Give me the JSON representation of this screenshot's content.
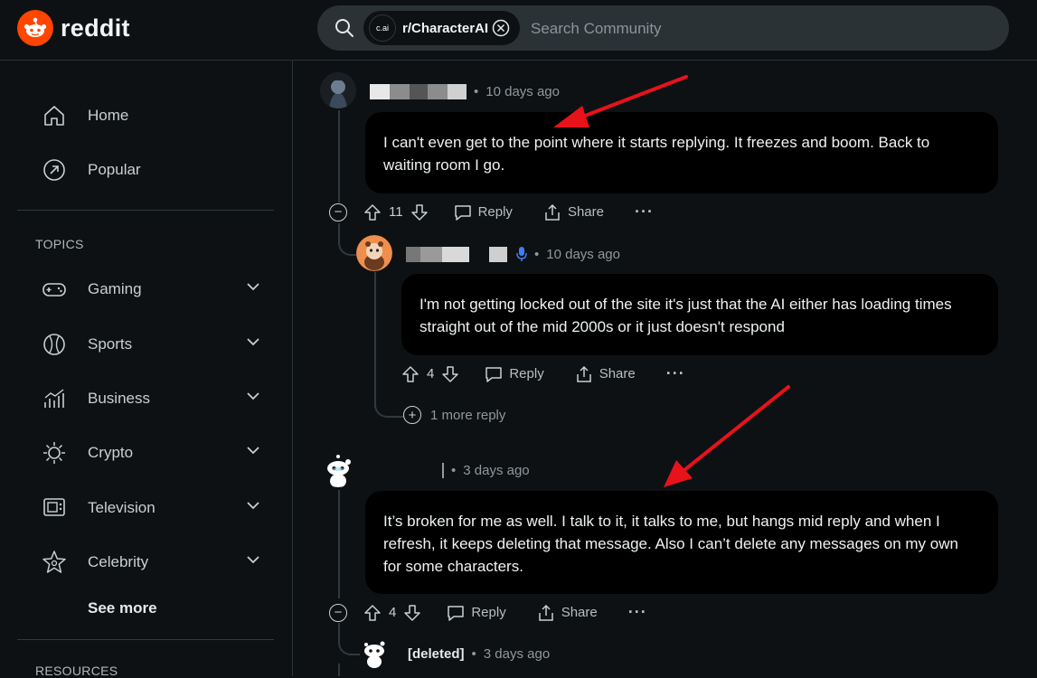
{
  "header": {
    "brand": "reddit",
    "community_chip": {
      "icon_text": "c.ai",
      "name": "r/CharacterAI"
    },
    "search_placeholder": "Search Community"
  },
  "sidebar": {
    "nav": [
      {
        "label": "Home",
        "icon": "home-icon"
      },
      {
        "label": "Popular",
        "icon": "popular-icon"
      }
    ],
    "topics_heading": "TOPICS",
    "topics": [
      {
        "label": "Gaming",
        "icon": "gamepad-icon"
      },
      {
        "label": "Sports",
        "icon": "sports-ball-icon"
      },
      {
        "label": "Business",
        "icon": "chart-icon"
      },
      {
        "label": "Crypto",
        "icon": "crypto-icon"
      },
      {
        "label": "Television",
        "icon": "tv-icon"
      },
      {
        "label": "Celebrity",
        "icon": "star-icon"
      }
    ],
    "see_more": "See more",
    "resources_heading": "RESOURCES"
  },
  "comments": [
    {
      "time": "10 days ago",
      "body": "I can't even get to the point where it starts replying. It freezes and boom. Back to waiting room I go.",
      "score": "11",
      "reply": "Reply",
      "share": "Share"
    },
    {
      "time": "10 days ago",
      "body": "I'm not getting locked out of the site it's just that the AI either has loading times straight out of the mid 2000s or it just doesn't respond",
      "score": "4",
      "reply": "Reply",
      "share": "Share",
      "more_replies": "1 more reply"
    },
    {
      "time": "3 days ago",
      "body": "It’s broken for me as well. I talk to it, it talks to me, but hangs mid reply and when I refresh, it keeps deleting that message. Also I can’t delete any messages on my own for some characters.",
      "score": "4",
      "reply": "Reply",
      "share": "Share"
    },
    {
      "author": "[deleted]",
      "time": "3 days ago"
    }
  ],
  "colors": {
    "background": "#0e1113",
    "bubble": "#000000",
    "brand": "#ff4500",
    "annotation_arrow": "#e8121b",
    "mic_badge": "#3d7bff"
  }
}
